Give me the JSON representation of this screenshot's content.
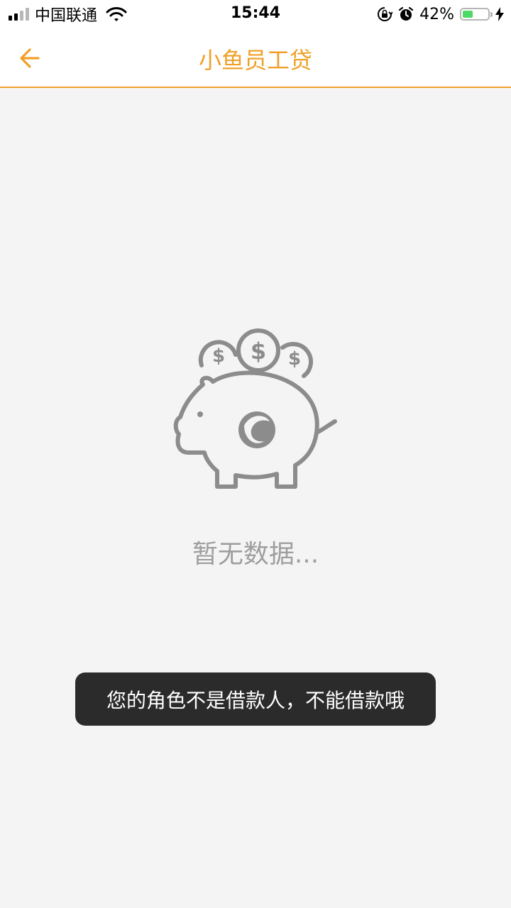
{
  "status_bar": {
    "carrier": "中国联通",
    "time": "15:44",
    "battery": "42%",
    "battery_level": 0.42,
    "icons": [
      "signal-icon",
      "wifi-icon",
      "rotation-lock-icon",
      "alarm-icon",
      "battery-icon",
      "charging-icon"
    ]
  },
  "nav": {
    "title": "小鱼员工贷",
    "back_icon": "arrow-left-icon"
  },
  "empty_state": {
    "icon": "piggy-bank-icon",
    "message": "暂无数据..."
  },
  "toast": {
    "message": "您的角色不是借款人，不能借款哦"
  },
  "colors": {
    "accent": "#f0a028",
    "background": "#f4f4f4",
    "toast_bg": "#2b2b2b",
    "empty_text": "#9e9e9e",
    "battery_fill": "#4cd964"
  }
}
